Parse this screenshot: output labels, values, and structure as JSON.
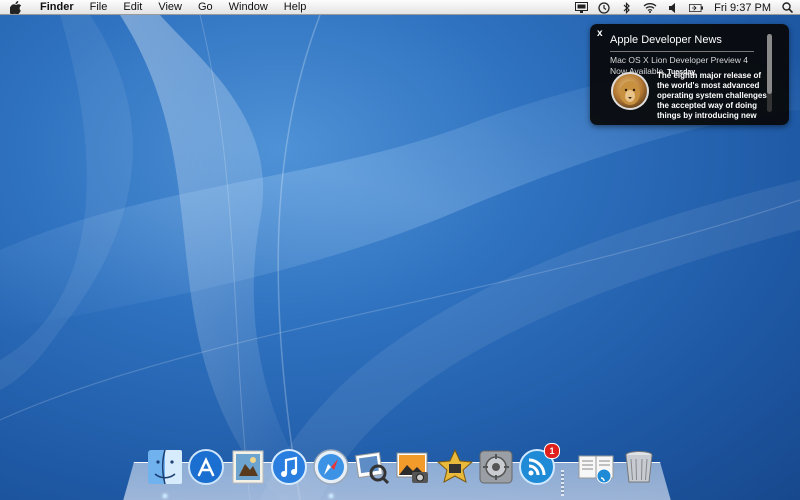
{
  "menubar": {
    "app_name": "Finder",
    "items": [
      "File",
      "Edit",
      "View",
      "Go",
      "Window",
      "Help"
    ],
    "status_icons": [
      "display-icon",
      "time-machine-icon",
      "bluetooth-icon",
      "wifi-icon",
      "volume-icon",
      "battery-icon"
    ],
    "clock": "Fri 9:37 PM"
  },
  "notification": {
    "close_label": "x",
    "title": "Apple Developer News",
    "headline": "Mac OS X Lion Developer Preview 4 Now Available",
    "date": "Tuesday",
    "body": "The eighth major release of the world's most advanced operating system challenges the accepted way of doing things by introducing new"
  },
  "dock": {
    "apps": [
      {
        "name": "Finder",
        "icon": "finder-icon"
      },
      {
        "name": "App Store",
        "icon": "app-store-icon"
      },
      {
        "name": "Mail",
        "icon": "mail-stamp-icon"
      },
      {
        "name": "iTunes",
        "icon": "itunes-icon"
      },
      {
        "name": "Safari",
        "icon": "safari-compass-icon"
      },
      {
        "name": "Preview",
        "icon": "preview-icon"
      },
      {
        "name": "iPhoto",
        "icon": "iphoto-icon"
      },
      {
        "name": "iMovie",
        "icon": "imovie-star-icon"
      },
      {
        "name": "System Preferences",
        "icon": "system-preferences-icon"
      },
      {
        "name": "RSS Reader",
        "icon": "rss-icon",
        "badge": "1"
      },
      {
        "name": "Documents",
        "icon": "document-stack-icon"
      },
      {
        "name": "Trash",
        "icon": "trash-icon"
      }
    ]
  },
  "colors": {
    "desktop_blue": "#2f72c0",
    "badge_red": "#e0211b",
    "notification_bg": "#080808"
  }
}
